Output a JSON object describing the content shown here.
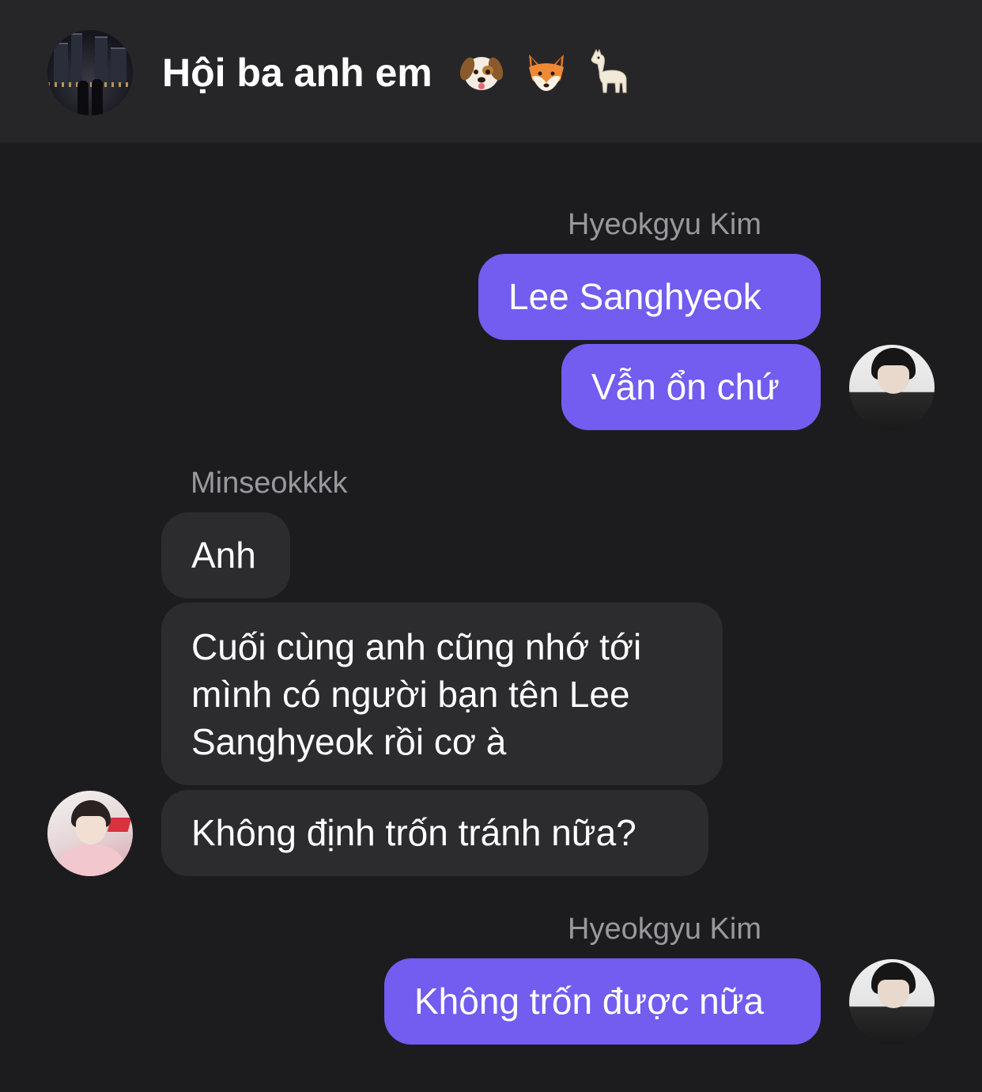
{
  "header": {
    "title": "Hội ba anh em",
    "emojis": [
      "dog-face-emoji",
      "fox-face-emoji",
      "llama-emoji"
    ]
  },
  "messages": [
    {
      "sender": "Hyeokgyu Kim",
      "direction": "outgoing",
      "bubbles": [
        "Lee Sanghyeok",
        "Vẫn ổn chứ"
      ]
    },
    {
      "sender": "Minseokkkk",
      "direction": "incoming",
      "bubbles": [
        "Anh",
        "Cuối cùng anh cũng nhớ tới mình có người bạn tên Lee Sanghyeok rồi cơ à",
        "Không định trốn tránh nữa?"
      ]
    },
    {
      "sender": "Hyeokgyu Kim",
      "direction": "outgoing",
      "bubbles": [
        "Không trốn được nữa"
      ]
    }
  ],
  "colors": {
    "background": "#1c1c1e",
    "header_background": "#262628",
    "outgoing_bubble": "#735cf0",
    "incoming_bubble": "#2c2c2e",
    "sender_name": "#98989f"
  }
}
